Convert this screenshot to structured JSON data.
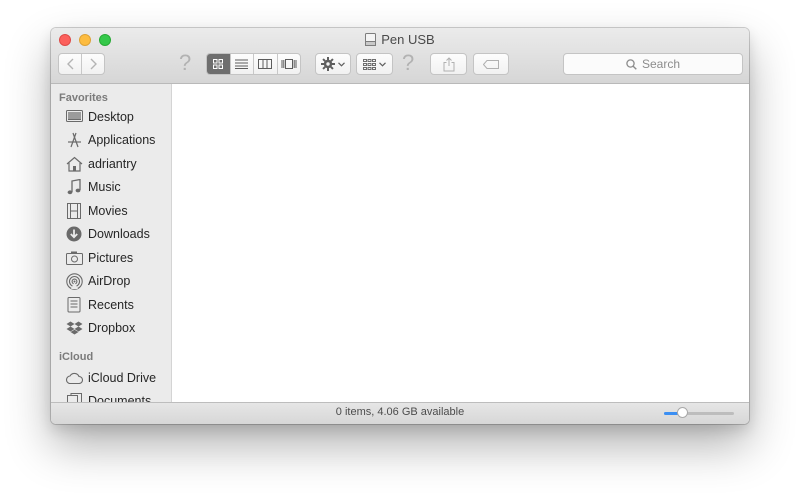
{
  "window": {
    "title": "Pen USB"
  },
  "toolbar": {
    "back_icon": "chevron-left-icon",
    "forward_icon": "chevron-right-icon",
    "help_mark": "?",
    "views": [
      "icon-view",
      "list-view",
      "column-view",
      "cover-flow-view"
    ],
    "active_view": "icon-view",
    "action_icon": "gear-icon",
    "arrange_icon": "arrange-icon",
    "share_icon": "share-icon",
    "tag_icon": "tag-icon",
    "search_placeholder": "Search"
  },
  "sidebar": {
    "favorites_header": "Favorites",
    "favorites": [
      {
        "label": "Desktop",
        "icon": "desktop-icon"
      },
      {
        "label": "Applications",
        "icon": "applications-icon"
      },
      {
        "label": "adriantry",
        "icon": "home-icon"
      },
      {
        "label": "Music",
        "icon": "music-icon"
      },
      {
        "label": "Movies",
        "icon": "movies-icon"
      },
      {
        "label": "Downloads",
        "icon": "downloads-icon"
      },
      {
        "label": "Pictures",
        "icon": "pictures-icon"
      },
      {
        "label": "AirDrop",
        "icon": "airdrop-icon"
      },
      {
        "label": "Recents",
        "icon": "recents-icon"
      },
      {
        "label": "Dropbox",
        "icon": "dropbox-icon"
      }
    ],
    "icloud_header": "iCloud",
    "icloud": [
      {
        "label": "iCloud Drive",
        "icon": "cloud-icon"
      },
      {
        "label": "Documents",
        "icon": "documents-icon"
      }
    ]
  },
  "statusbar": {
    "text": "0 items, 4.06 GB available",
    "zoom_level": 0.25
  },
  "colors": {
    "accent": "#3b8ff3",
    "close": "#fc605c",
    "minimize": "#fdbc40",
    "maximize": "#34c84a"
  }
}
